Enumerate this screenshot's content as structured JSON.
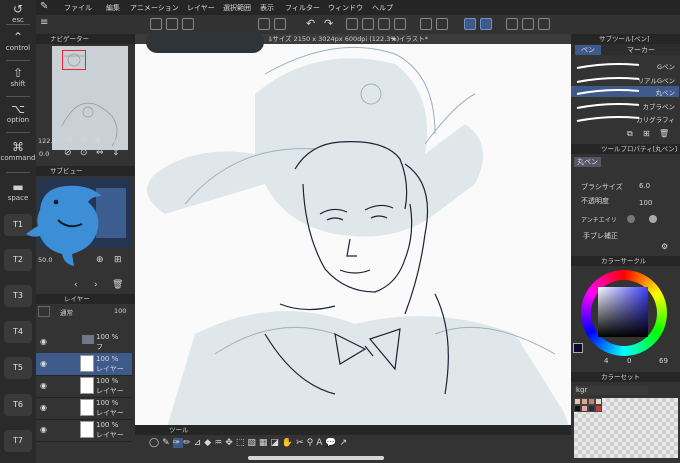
{
  "keys": {
    "esc": "esc",
    "control": "control",
    "shift": "shift",
    "option": "option",
    "command": "command",
    "space": "space",
    "t_keys": [
      "T1",
      "T2",
      "T3",
      "T4",
      "T5",
      "T6",
      "T7"
    ]
  },
  "menu": [
    "ファイル",
    "編集",
    "アニメーション",
    "レイヤー",
    "選択範囲",
    "表示",
    "フィルター",
    "ウィンドウ",
    "ヘルプ"
  ],
  "canvas": {
    "tab_title": "ﾙサイズ 2150 x 3024px 600dpi (122.3%)",
    "tab2": "★ イラスト*"
  },
  "navigator": {
    "title": "ナビゲーター",
    "zoom": "122.3",
    "rotation": "0.0"
  },
  "subview": {
    "title": "サブビュー",
    "zoom": "50.0"
  },
  "layers": {
    "title": "レイヤー",
    "blend": "通常",
    "opacity": "100",
    "rows": [
      {
        "pct": "100 %",
        "name": "フ"
      },
      {
        "pct": "100 %",
        "name": "レイヤー"
      },
      {
        "pct": "100 %",
        "name": "レイヤー"
      },
      {
        "pct": "100 %",
        "name": "レイヤー"
      },
      {
        "pct": "100 %",
        "name": "レイヤー"
      }
    ]
  },
  "subtool": {
    "title": "サブツール[ペン]",
    "tabs": [
      "ペン",
      "マーカー"
    ],
    "brushes": [
      "Gペン",
      "リアルGペン",
      "丸ペン",
      "カブラペン",
      "カリグラフィ"
    ]
  },
  "toolprop": {
    "title": "ツールプロパティ[丸ペン]",
    "name": "丸ペン",
    "brush_size_label": "ブラシサイズ",
    "brush_size": "6.0",
    "opacity_label": "不透明度",
    "opacity": "100",
    "antialias_label": "アンチエイリ",
    "stabilize_label": "手ブレ補正"
  },
  "color": {
    "wheel_title": "カラーサークル",
    "values": [
      "4",
      "0",
      "69"
    ],
    "set_title": "カラーセット",
    "set_name": "kgr"
  },
  "toolpanel": {
    "title": "ツール"
  }
}
